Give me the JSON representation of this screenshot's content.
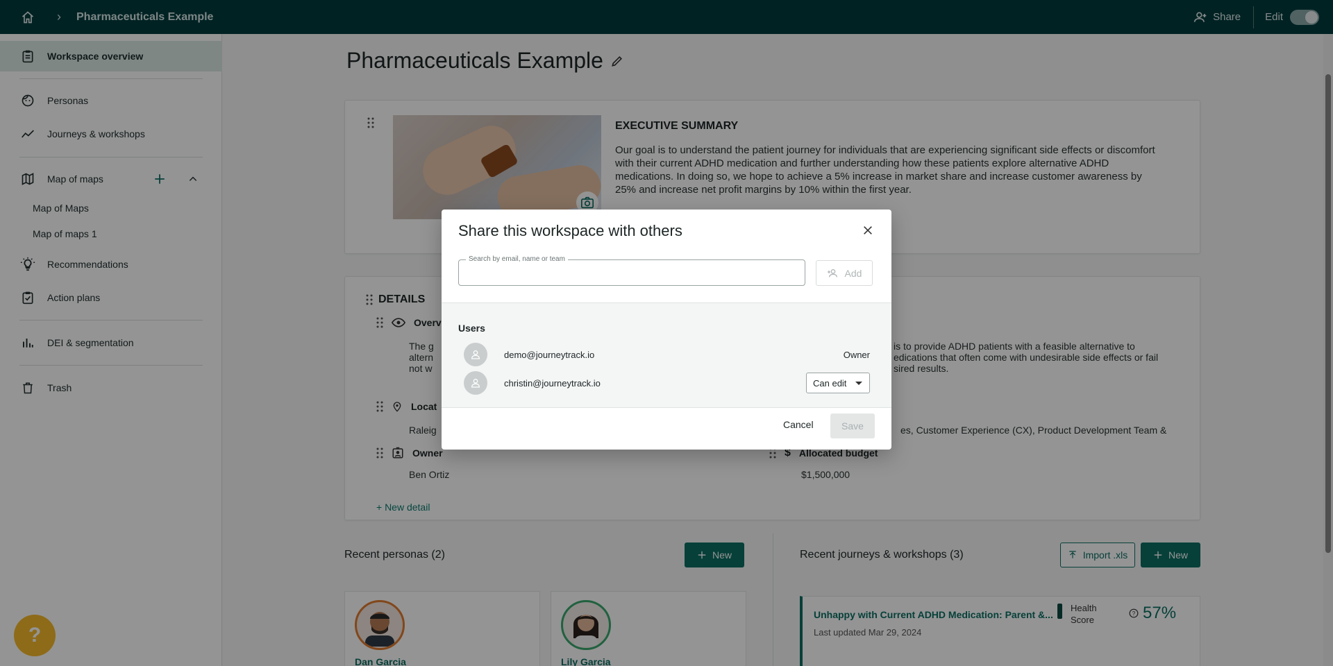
{
  "topbar": {
    "icons": {
      "home": "home-icon",
      "separator": "chevron-right-icon",
      "share": "person-add-icon"
    },
    "breadcrumb_title": "Pharmaceuticals Example",
    "share_label": "Share",
    "edit_label": "Edit",
    "edit_toggle_on": true,
    "bg_color": "#003c3d"
  },
  "sidebar": {
    "items": [
      {
        "label": "Workspace overview",
        "icon": "clipboard-icon",
        "active": true
      },
      {
        "label": "Personas",
        "icon": "face-icon"
      },
      {
        "label": "Journeys & workshops",
        "icon": "trending-icon"
      },
      {
        "label": "Map of maps",
        "icon": "map-icon"
      },
      {
        "label": "Recommendations",
        "icon": "lightbulb-icon"
      },
      {
        "label": "Action plans",
        "icon": "checklist-icon"
      },
      {
        "label": "DEI & segmentation",
        "icon": "bar-chart-icon"
      },
      {
        "label": "Trash",
        "icon": "trash-icon"
      }
    ],
    "map_submenu": [
      "Map of Maps",
      "Map of maps 1"
    ],
    "active_bg": "#dbe8e6"
  },
  "main": {
    "page_title": "Pharmaceuticals Example",
    "executive_summary": {
      "title": "EXECUTIVE SUMMARY",
      "text": "Our goal is to understand the patient journey for individuals that are experiencing significant side effects or discomfort with their current ADHD medication and further understanding how these patients explore alternative ADHD medications. In doing so, we hope to achieve a 5% increase in market share and increase customer awareness by 25% and increase net profit margins by 10% within the first year."
    },
    "details": {
      "title": "DETAILS",
      "overview_label": "Overv",
      "overview_text_left": [
        "The g",
        "altern",
        "not w"
      ],
      "overview_text_right": [
        "is to provide ADHD patients with a feasible alternative to",
        "edications that often come with undesirable side effects or fail",
        "sired results."
      ],
      "location_label": "Locat",
      "location_value": "Raleig",
      "teams_value": "es, Customer Experience (CX), Product Development  Team &",
      "owner_label": "Owner",
      "owner_value": "Ben Ortiz",
      "budget_label": "Allocated budget",
      "budget_value": "$1,500,000",
      "new_detail": "+ New detail"
    },
    "recent_personas": {
      "title": "Recent personas (2)",
      "new_label": "New",
      "items": [
        {
          "name": "Dan Garcia",
          "ring_color": "#e07a2f"
        },
        {
          "name": "Lily Garcia",
          "ring_color": "#3aa76d"
        }
      ]
    },
    "recent_journeys": {
      "title": "Recent journeys & workshops (3)",
      "import_label": "Import .xls",
      "new_label": "New",
      "item": {
        "title": "Unhappy with Current ADHD Medication: Parent &...",
        "updated": "Last updated Mar 29, 2024",
        "health_label_line1": "Health",
        "health_label_line2": "Score",
        "health_value": "57%"
      }
    }
  },
  "dialog": {
    "title": "Share this workspace with others",
    "search_label": "Search by email, name or team",
    "search_value": "",
    "add_label": "Add",
    "users_heading": "Users",
    "users": [
      {
        "email": "demo@journeytrack.io",
        "role": "Owner"
      },
      {
        "email": "christin@journeytrack.io",
        "role": "Can edit"
      }
    ],
    "cancel_label": "Cancel",
    "save_label": "Save"
  },
  "help_label": "?",
  "colors": {
    "accent": "#0b6e63",
    "help": "#f5b92c"
  }
}
